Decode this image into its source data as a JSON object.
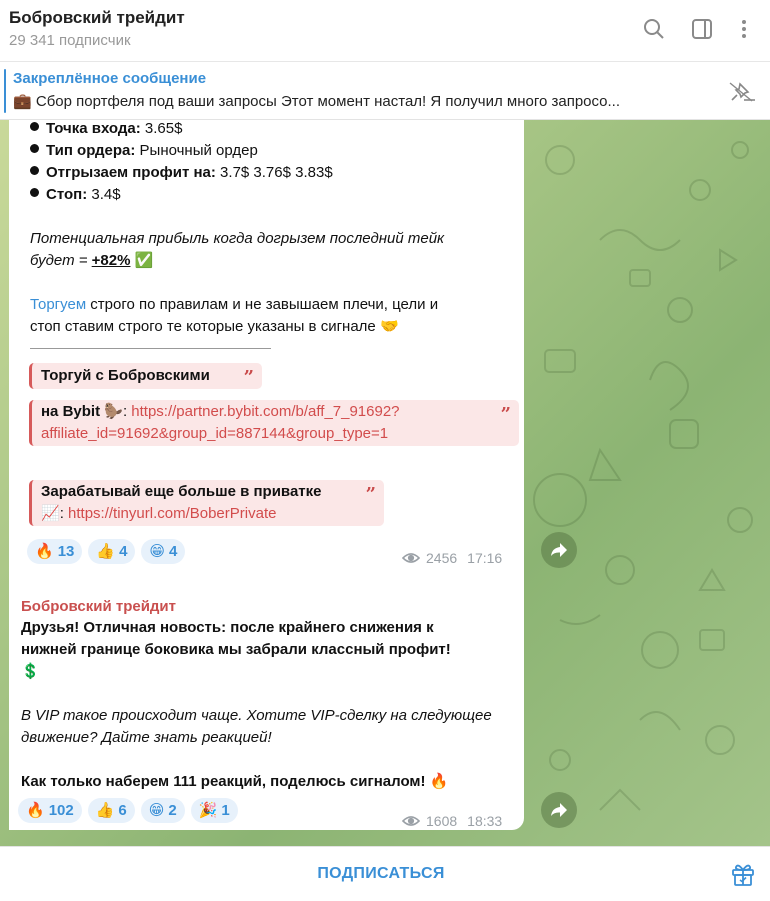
{
  "header": {
    "title": "Бобровский трейдит",
    "subscribers": "29 341 подписчик"
  },
  "pinned": {
    "title": "Закреплённое сообщение",
    "emoji": "💼",
    "text": "Сбор портфеля под ваши запросы   Этот момент настал! Я получил много запросо..."
  },
  "post1": {
    "bullets": [
      {
        "label": "Точка входа:",
        "value": " 3.65$"
      },
      {
        "label": "Тип ордера:",
        "value": " Рыночный ордер"
      },
      {
        "label": "Отгрызаем профит на:",
        "value": " 3.7$ 3.76$ 3.83$"
      },
      {
        "label": "Стоп:",
        "value": " 3.4$"
      }
    ],
    "potential_line1": "Потенциальная прибыль когда догрызем последний тейк",
    "potential_line2_prefix": "будет = ",
    "potential_value": "+82%",
    "potential_emoji": "✅",
    "trade_link": "Торгуем",
    "trade_rest1": " строго по правилам и не завышаем плечи, цели и",
    "trade_line2": "стоп ставим строго те которые указаны в сигнале",
    "trade_emoji": "🤝",
    "quote1": "Торгуй с Бобровскими",
    "quote2_label": " на Bybit",
    "quote2_emoji": "🦫",
    "quote2_link_line1": "https://partner.bybit.com/b/aff_7_91692?",
    "quote2_link_line2": "affiliate_id=91692&group_id=887144&group_type=1",
    "quote3_title": "Зарабатывай еще больше в приватке",
    "quote3_emoji": "📈",
    "quote3_link": "https://tinyurl.com/BoberPrivate",
    "reactions": [
      {
        "emoji": "🔥",
        "count": "13"
      },
      {
        "emoji": "👍",
        "count": "4"
      },
      {
        "emoji": "😁",
        "count": "4"
      }
    ],
    "views": "2456",
    "time": "17:16"
  },
  "post2": {
    "author": "Бобровский трейдит",
    "line1": "Друзья! Отличная новость: после крайнего снижения к",
    "line2": "нижней границе боковика мы забрали классный профит!",
    "line3_emoji": "💲",
    "italic1": "В VIP такое происходит чаще. Хотите VIP-сделку на следующее",
    "italic2": "движение? Дайте знать реакцией!",
    "final": "Как только наберем 111 реакций, поделюсь сигналом!",
    "final_emoji": "🔥",
    "reactions": [
      {
        "emoji": "🔥",
        "count": "102"
      },
      {
        "emoji": "👍",
        "count": "6"
      },
      {
        "emoji": "😁",
        "count": "2"
      },
      {
        "emoji": "🎉",
        "count": "1"
      }
    ],
    "views": "1608",
    "time": "18:33"
  },
  "footer": {
    "subscribe": "ПОДПИСАТЬСЯ"
  },
  "colors": {
    "accent": "#3a8fd6",
    "author": "#c9504f",
    "quote_bg": "#fbe7e7",
    "chat_bg": "#a7c585"
  },
  "icons": [
    "search-icon",
    "sidebar-toggle-icon",
    "more-icon",
    "unpin-icon",
    "eye-icon",
    "share-icon",
    "gift-icon"
  ]
}
